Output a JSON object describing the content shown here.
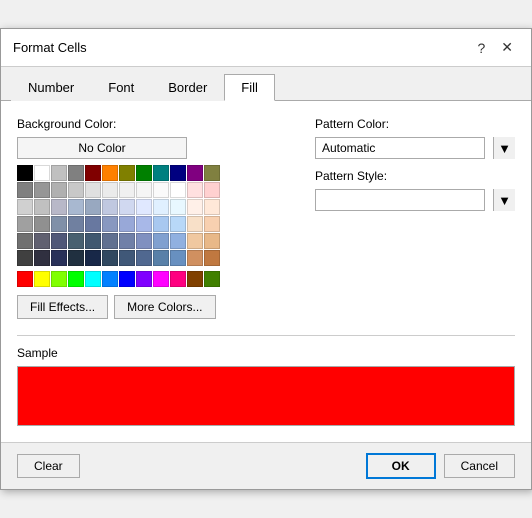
{
  "dialog": {
    "title": "Format Cells",
    "help_icon": "?",
    "close_icon": "✕"
  },
  "tabs": [
    {
      "label": "Number",
      "active": false
    },
    {
      "label": "Font",
      "active": false
    },
    {
      "label": "Border",
      "active": false
    },
    {
      "label": "Fill",
      "active": true
    }
  ],
  "fill": {
    "background_color_label": "Background Color:",
    "no_color_button": "No Color",
    "pattern_color_label": "Pattern Color:",
    "pattern_color_value": "Automatic",
    "pattern_style_label": "Pattern Style:",
    "fill_effects_button": "Fill Effects...",
    "more_colors_button": "More Colors...",
    "sample_label": "Sample",
    "sample_color": "#FF0000"
  },
  "buttons": {
    "clear": "Clear",
    "ok": "OK",
    "cancel": "Cancel"
  },
  "color_rows": [
    [
      "#000000",
      "#FFFFFF",
      "#C0C0C0",
      "#808080",
      "#800000",
      "#FF8000",
      "#808000",
      "#008000",
      "#008080",
      "#000080",
      "#800080",
      "#808040"
    ],
    [
      "#808080",
      "#969696",
      "#B0B0B0",
      "#C8C8C8",
      "#E0E0E0",
      "#EBEBEB",
      "#F0F0F0",
      "#F5F5F5",
      "#FAFAFA",
      "#FFFFFF",
      "#FFE0E0",
      "#FFD0D0"
    ],
    [
      "#D0D0D0",
      "#C0C0C0",
      "#B8B8C8",
      "#A8B8D0",
      "#98A8C0",
      "#C0C8E0",
      "#D0D8F0",
      "#E0E8FF",
      "#E0F0FF",
      "#E8F8FF",
      "#FFF0E8",
      "#FFE8D8"
    ],
    [
      "#A0A0A0",
      "#909090",
      "#8090A8",
      "#7080A0",
      "#6878A0",
      "#8898C0",
      "#98A8D8",
      "#A8B8E8",
      "#A8C8F0",
      "#B8D8F8",
      "#F8E0C8",
      "#F8D0B0"
    ],
    [
      "#707070",
      "#606070",
      "#505878",
      "#486070",
      "#405870",
      "#607090",
      "#7080A8",
      "#8090C0",
      "#80A0D0",
      "#90B0E0",
      "#F0C8A0",
      "#E8B888"
    ],
    [
      "#404040",
      "#303040",
      "#283058",
      "#203040",
      "#182848",
      "#304860",
      "#405878",
      "#506890",
      "#5880A8",
      "#6890C0",
      "#D09060",
      "#C07840"
    ],
    [
      "#FF0000",
      "#FFFF00",
      "#80FF00",
      "#00FF00",
      "#00FFFF",
      "#0080FF",
      "#0000FF",
      "#8000FF",
      "#FF00FF",
      "#FF0080",
      "#804000",
      "#408000"
    ]
  ]
}
